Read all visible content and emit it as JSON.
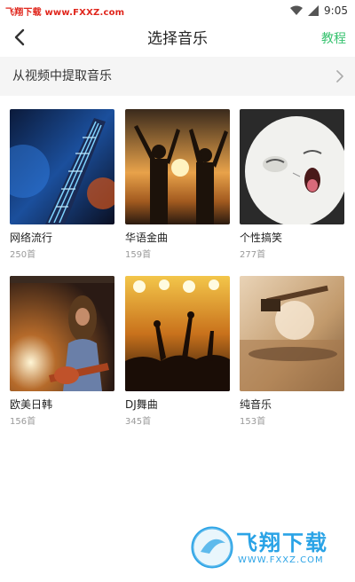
{
  "status_bar": {
    "watermark_text": "飞翔下载 www.FXXZ.com",
    "time": "9:05"
  },
  "header": {
    "title": "选择音乐",
    "help_label": "教程"
  },
  "extract": {
    "label": "从视频中提取音乐"
  },
  "categories": [
    {
      "name": "网络流行",
      "count": "250首"
    },
    {
      "name": "华语金曲",
      "count": "159首"
    },
    {
      "name": "个性搞笑",
      "count": "277首"
    },
    {
      "name": "欧美日韩",
      "count": "156首"
    },
    {
      "name": "DJ舞曲",
      "count": "345首"
    },
    {
      "name": "纯音乐",
      "count": "153首"
    }
  ],
  "watermark": {
    "brand": "飞翔下载",
    "url": "WWW.FXXZ.COM"
  },
  "colors": {
    "accent": "#35c26e",
    "watermark_red": "#e0261c",
    "watermark_blue": "#2aa3e6"
  }
}
